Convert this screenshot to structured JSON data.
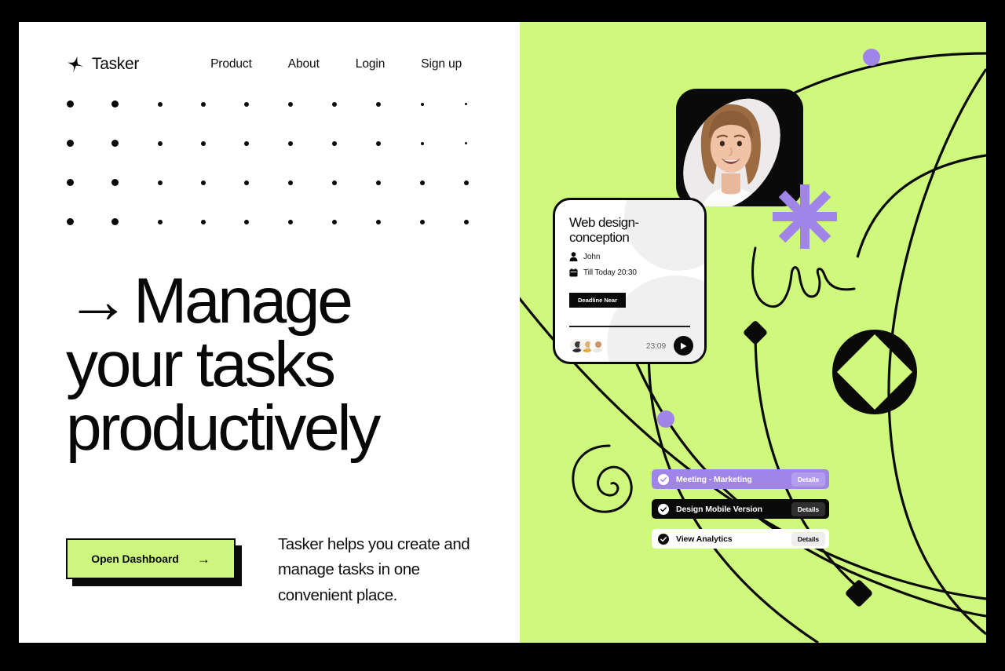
{
  "brand": {
    "name": "Tasker",
    "logo_icon": "sparkle-icon"
  },
  "nav": {
    "links": [
      {
        "label": "Product"
      },
      {
        "label": "About"
      },
      {
        "label": "Login"
      },
      {
        "label": "Sign up"
      }
    ]
  },
  "hero": {
    "arrow": "→",
    "line1": "Manage",
    "line2": "your tasks",
    "line3": "productively",
    "subtext": "Tasker helps you create and manage tasks in one convenient place.",
    "cta_label": "Open Dashboard",
    "cta_arrow": "→"
  },
  "task_card": {
    "title": "Web design-conception",
    "assignee_icon": "person-icon",
    "assignee": "John",
    "due_icon": "calendar-icon",
    "due": "Till Today 20:30",
    "badge": "Deadline Near",
    "timer": "23:09",
    "play_icon": "play-icon",
    "avatars": [
      "avatar-1",
      "avatar-2",
      "avatar-3"
    ]
  },
  "task_pills": [
    {
      "label": "Meeting - Marketing",
      "details_label": "Details",
      "check_icon": "check-circle-icon",
      "style": "purple"
    },
    {
      "label": "Design Mobile Version",
      "details_label": "Details",
      "check_icon": "check-circle-icon",
      "style": "black"
    },
    {
      "label": "View Analytics",
      "details_label": "Details",
      "check_icon": "check-circle-icon",
      "style": "white"
    }
  ],
  "decor": {
    "asterisk_icon": "asterisk-star-icon",
    "circle_diamond_icon": "circle-diamond-icon",
    "squiggle_icon": "loop-squiggle-icon",
    "spiral_icon": "spiral-icon",
    "orbit_icon": "orbit-lines-icon",
    "purple_node_icon": "purple-dot-node-icon",
    "diamond_node_icon": "black-diamond-node-icon",
    "dot_grid_icon": "dot-grid-icon"
  },
  "colors": {
    "green": "#CFF97C",
    "purple": "#A184E8",
    "black": "#0A0A0A",
    "white": "#FFFFFF",
    "button_green": "#CDF67E"
  }
}
